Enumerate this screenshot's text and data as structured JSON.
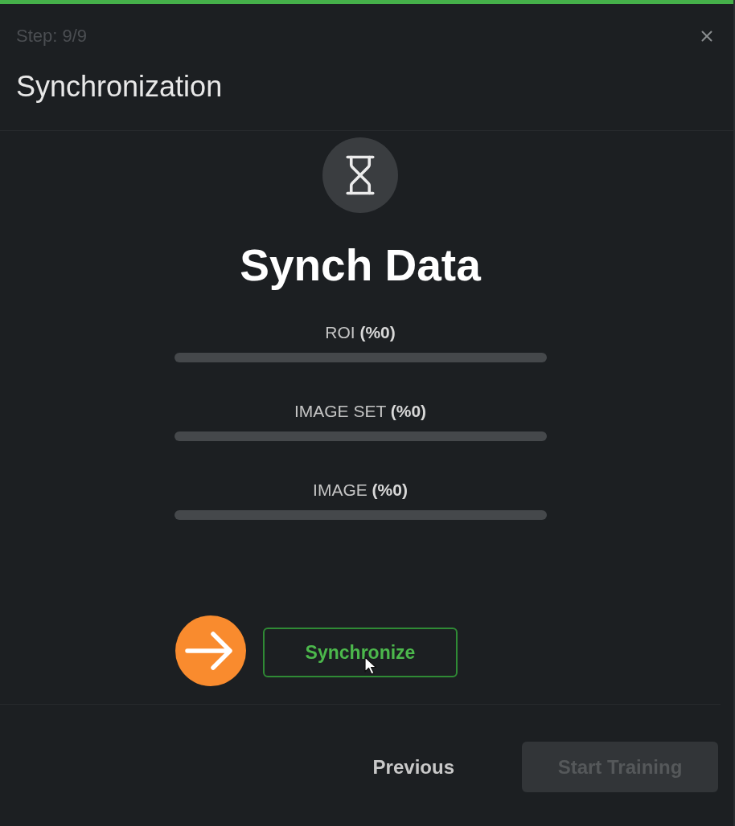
{
  "step_progress": {
    "level": 1
  },
  "header": {
    "step": "Step: 9/9",
    "title": "Synchronization"
  },
  "sync": {
    "heading": "Synch Data",
    "items": [
      {
        "label": "ROI **(%0)**",
        "level": 0
      },
      {
        "label": "IMAGE SET **(%0)**",
        "level": 0
      },
      {
        "label": "IMAGE **(%0)**",
        "level": 0
      }
    ],
    "button": "Synchronize"
  },
  "footer": {
    "buttons": [
      {
        "label": "Previous",
        "kind": "text",
        "disabled": false
      },
      {
        "label": "Start Training",
        "kind": "filled",
        "disabled": true
      }
    ]
  }
}
